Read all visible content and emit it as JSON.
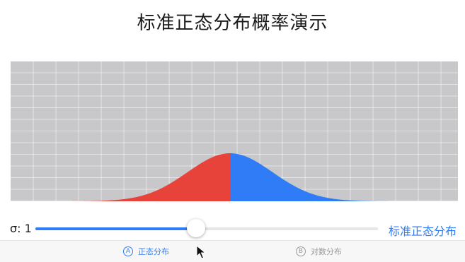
{
  "page": {
    "title": "标准正态分布概率演示"
  },
  "colors": {
    "accent": "#2f7cf6",
    "left_area": "#e8433b",
    "right_area": "#2f7cf6",
    "plot_bg": "#c8c8ca",
    "grid": "#ffffff"
  },
  "chart_data": {
    "type": "area",
    "title": "",
    "xlabel": "",
    "ylabel": "",
    "distribution": "normal",
    "mean": 0,
    "sigma": 1,
    "split_at_x": 0,
    "series": [
      {
        "side": "left",
        "color": "#e8433b"
      },
      {
        "side": "right",
        "color": "#2f7cf6"
      }
    ],
    "grid": true
  },
  "controls": {
    "sigma_label": "σ: 1",
    "sigma_fraction": 0.47,
    "mode_label": "标准正态分布"
  },
  "tabs": [
    {
      "badge": "A",
      "label": "正态分布",
      "active": true,
      "icon": "circle-a-icon"
    },
    {
      "badge": "B",
      "label": "对数分布",
      "active": false,
      "icon": "circle-b-icon"
    }
  ]
}
